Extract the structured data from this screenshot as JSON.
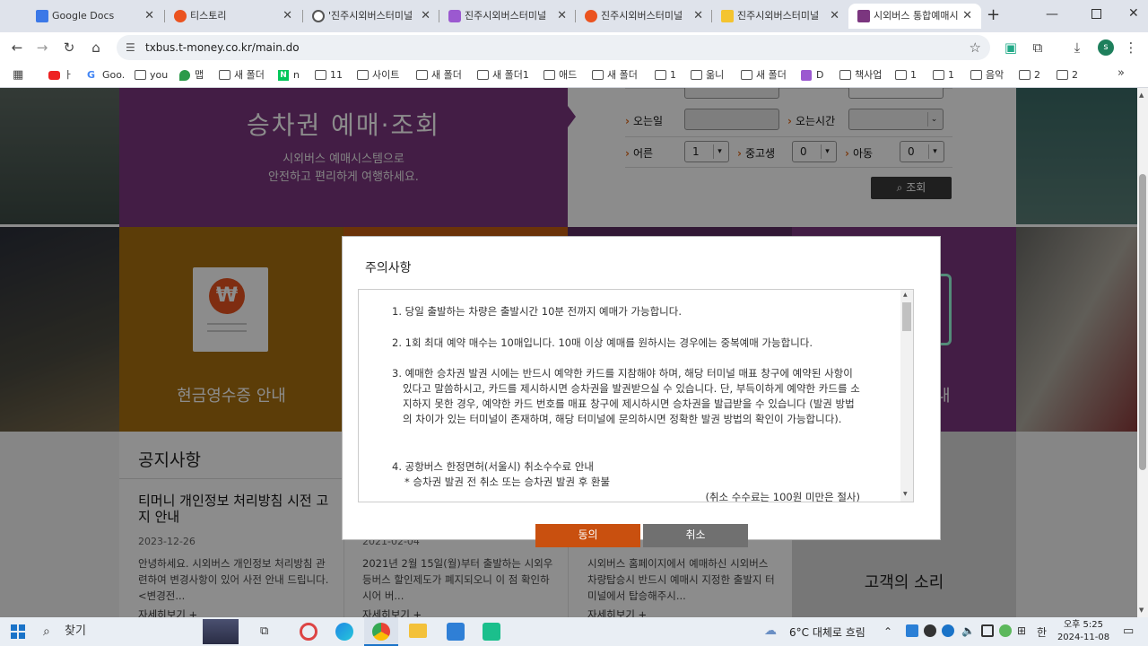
{
  "browser": {
    "tabs": [
      {
        "title": "Google Docs",
        "color": "#3b78e7"
      },
      {
        "title": "티스토리",
        "color": "#eb531f"
      },
      {
        "title": "'진주시외버스터미널",
        "color": "#555555"
      },
      {
        "title": "진주시외버스터미널",
        "color": "#9b59d0"
      },
      {
        "title": "진주시외버스터미널",
        "color": "#eb531f"
      },
      {
        "title": "진주시외버스터미널",
        "color": "#f4c430"
      },
      {
        "title": "시외버스 통합예매시",
        "color": "#7b367f"
      }
    ],
    "url": "txbus.t-money.co.kr/main.do",
    "profile_initial": "s",
    "bookmarks": [
      "ㅏ",
      "Goo.",
      "you",
      "맵",
      "새 폴더",
      "n",
      "11",
      "사이트",
      "새 폴더",
      "새 폴더1",
      "애드",
      "새 폴더",
      "1",
      "옮니",
      "새 폴더",
      "D",
      "책사업",
      "1",
      "1",
      "음악",
      "2",
      "2"
    ]
  },
  "hero": {
    "title": "승차권 예매·조회",
    "subtitle_line1": "시외버스 예매시스템으로",
    "subtitle_line2": "안전하고 편리하게 여행하세요."
  },
  "search_form": {
    "return_date_label": "오는일",
    "return_time_label": "오는시간",
    "adult_label": "어른",
    "adult_value": "1",
    "teen_label": "중고생",
    "teen_value": "0",
    "child_label": "아동",
    "child_value": "0",
    "search_button": "조회"
  },
  "tiles": {
    "receipt": {
      "label": "현금영수증 안내",
      "won": "₩"
    },
    "right_partial": "내"
  },
  "notices": {
    "section_title": "공지사항",
    "items": [
      {
        "title": "티머니 개인정보 처리방침 시전 고지 안내",
        "date": "2023-12-26",
        "body": "안녕하세요. 시외버스 개인정보 처리방침 관련하여 변경사항이 있어 사전 안내 드립니다. <변경전...",
        "more": "자세히보기 +"
      },
      {
        "title": "",
        "date": "2021-02-04",
        "body": "2021년 2월 15일(월)부터 출발하는 시외우등버스 할인제도가 폐지되오니 이 점 확인하시어 버...",
        "more": "자세히보기 +"
      },
      {
        "title": "",
        "date": "",
        "body": "시외버스 홈페이지에서 예매하신 시외버스 차량탑승시 반드시 예매시 지정한 출발지 터미널에서 탑승해주시...",
        "more": "자세히보기 +"
      }
    ],
    "voice_title": "고객의 소리"
  },
  "modal": {
    "title": "주의사항",
    "items": [
      "1. 당일 출발하는 차량은 출발시간 10분 전까지 예매가 가능합니다.",
      "2. 1회 최대 예약 매수는 10매입니다. 10매 이상 예매를 원하시는 경우에는 중복예매 가능합니다.",
      "3. 예매한 승차권 발권 시에는 반드시 예약한 카드를 지참해야 하며, 해당 터미널 매표 창구에 예약된 사항이 있다고 말씀하시고, 카드를 제시하시면 승차권을 발권받으실 수 있습니다. 단, 부득이하게 예약한 카드를 소지하지 못한 경우, 예약한 카드 번호를 매표 창구에 제시하시면 승차권을 발급받을 수 있습니다 (발권 방법의 차이가 있는 터미널이 존재하며, 해당 터미널에 문의하시면 정확한 발권 방법의 확인이 가능합니다).",
      "4. 공항버스 한정면허(서울시) 취소수수료 안내",
      "* 승차권 발권 전 취소 또는 승차권 발권 후 환불",
      "(취소 수수료는 100원 미만은 절사)"
    ],
    "agree_button": "동의",
    "cancel_button": "취소"
  },
  "taskbar": {
    "search_label": "찾기",
    "weather": "6°C  대체로 흐림",
    "time": "오후 5:25",
    "date": "2024-11-08"
  },
  "colors": {
    "purple": "#7b367f",
    "brown": "#a8700f",
    "agree": "#c9500f",
    "cancel": "#707070"
  }
}
